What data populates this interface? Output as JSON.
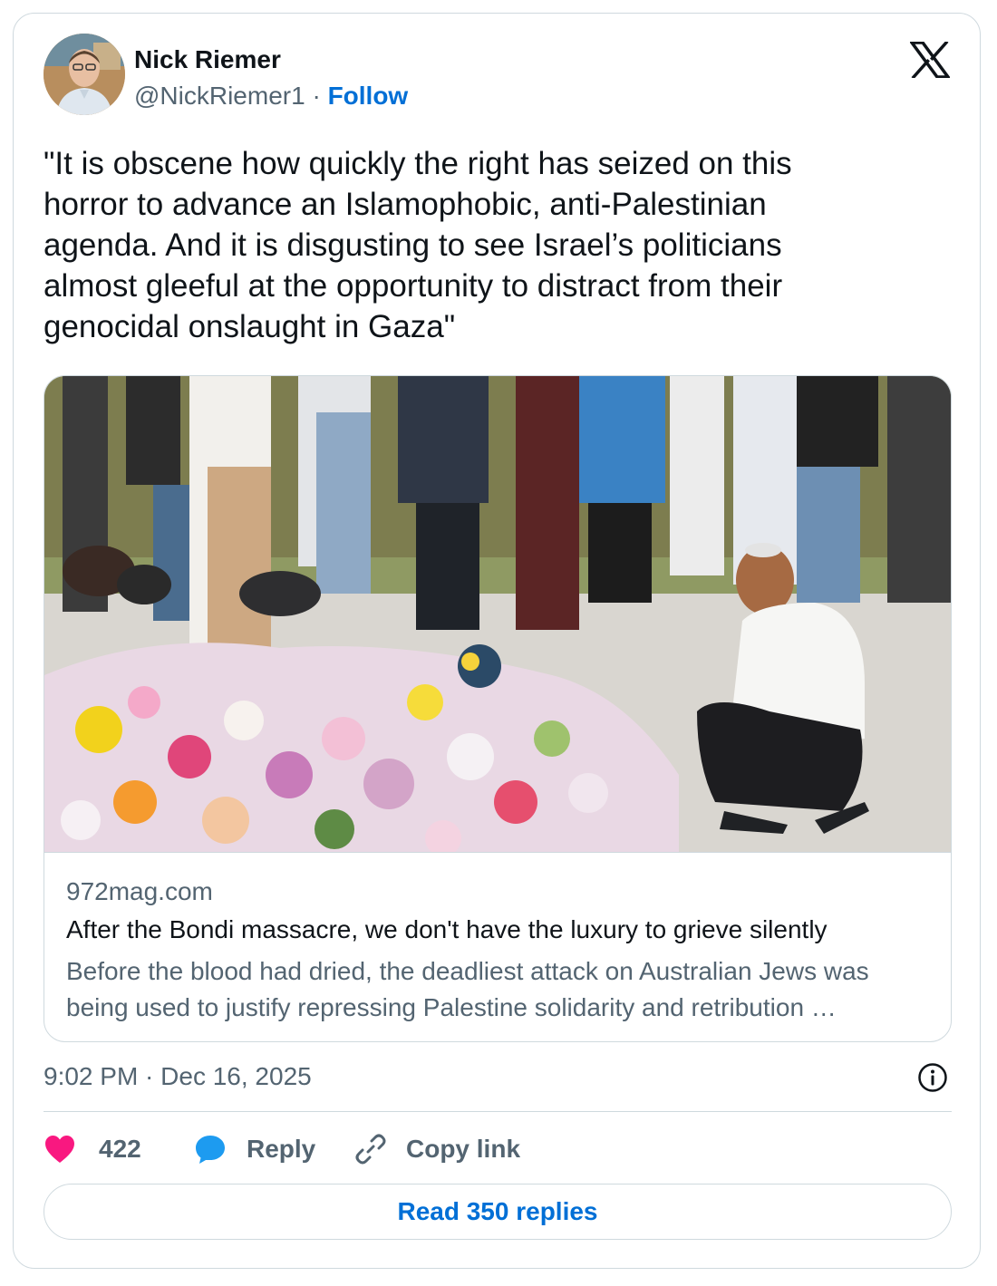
{
  "author": {
    "name": "Nick Riemer",
    "handle": "@NickRiemer1",
    "separator": "·",
    "follow_label": "Follow"
  },
  "tweet": {
    "text": "\"It is obscene how quickly the right has  seized on this\nhorror to advance an Islamophobic, anti-Palestinian\nagenda. And it is disgusting to see Israel’s politicians\nalmost gleeful  at the opportunity to distract from their\ngenocidal onslaught in Gaza\""
  },
  "link_card": {
    "domain": "972mag.com",
    "title": "After the Bondi massacre, we don't have the luxury to grieve silently",
    "description": "Before the blood had dried, the deadliest attack on Australian Jews was being used to justify repressing Palestine solidarity and retribution …"
  },
  "timestamp": "9:02 PM · Dec 16, 2025",
  "actions": {
    "like_count": "422",
    "reply_label": "Reply",
    "copy_link_label": "Copy link"
  },
  "read_replies_label": "Read 350 replies",
  "icons": {
    "logo": "x-logo-icon",
    "info": "info-icon",
    "like": "heart-icon",
    "reply": "speech-bubble-icon",
    "copy": "link-icon"
  },
  "colors": {
    "accent": "#006fd6",
    "like": "#f91880",
    "reply": "#1d9bf0",
    "secondary_text": "#536471",
    "border": "#cfd9de"
  }
}
